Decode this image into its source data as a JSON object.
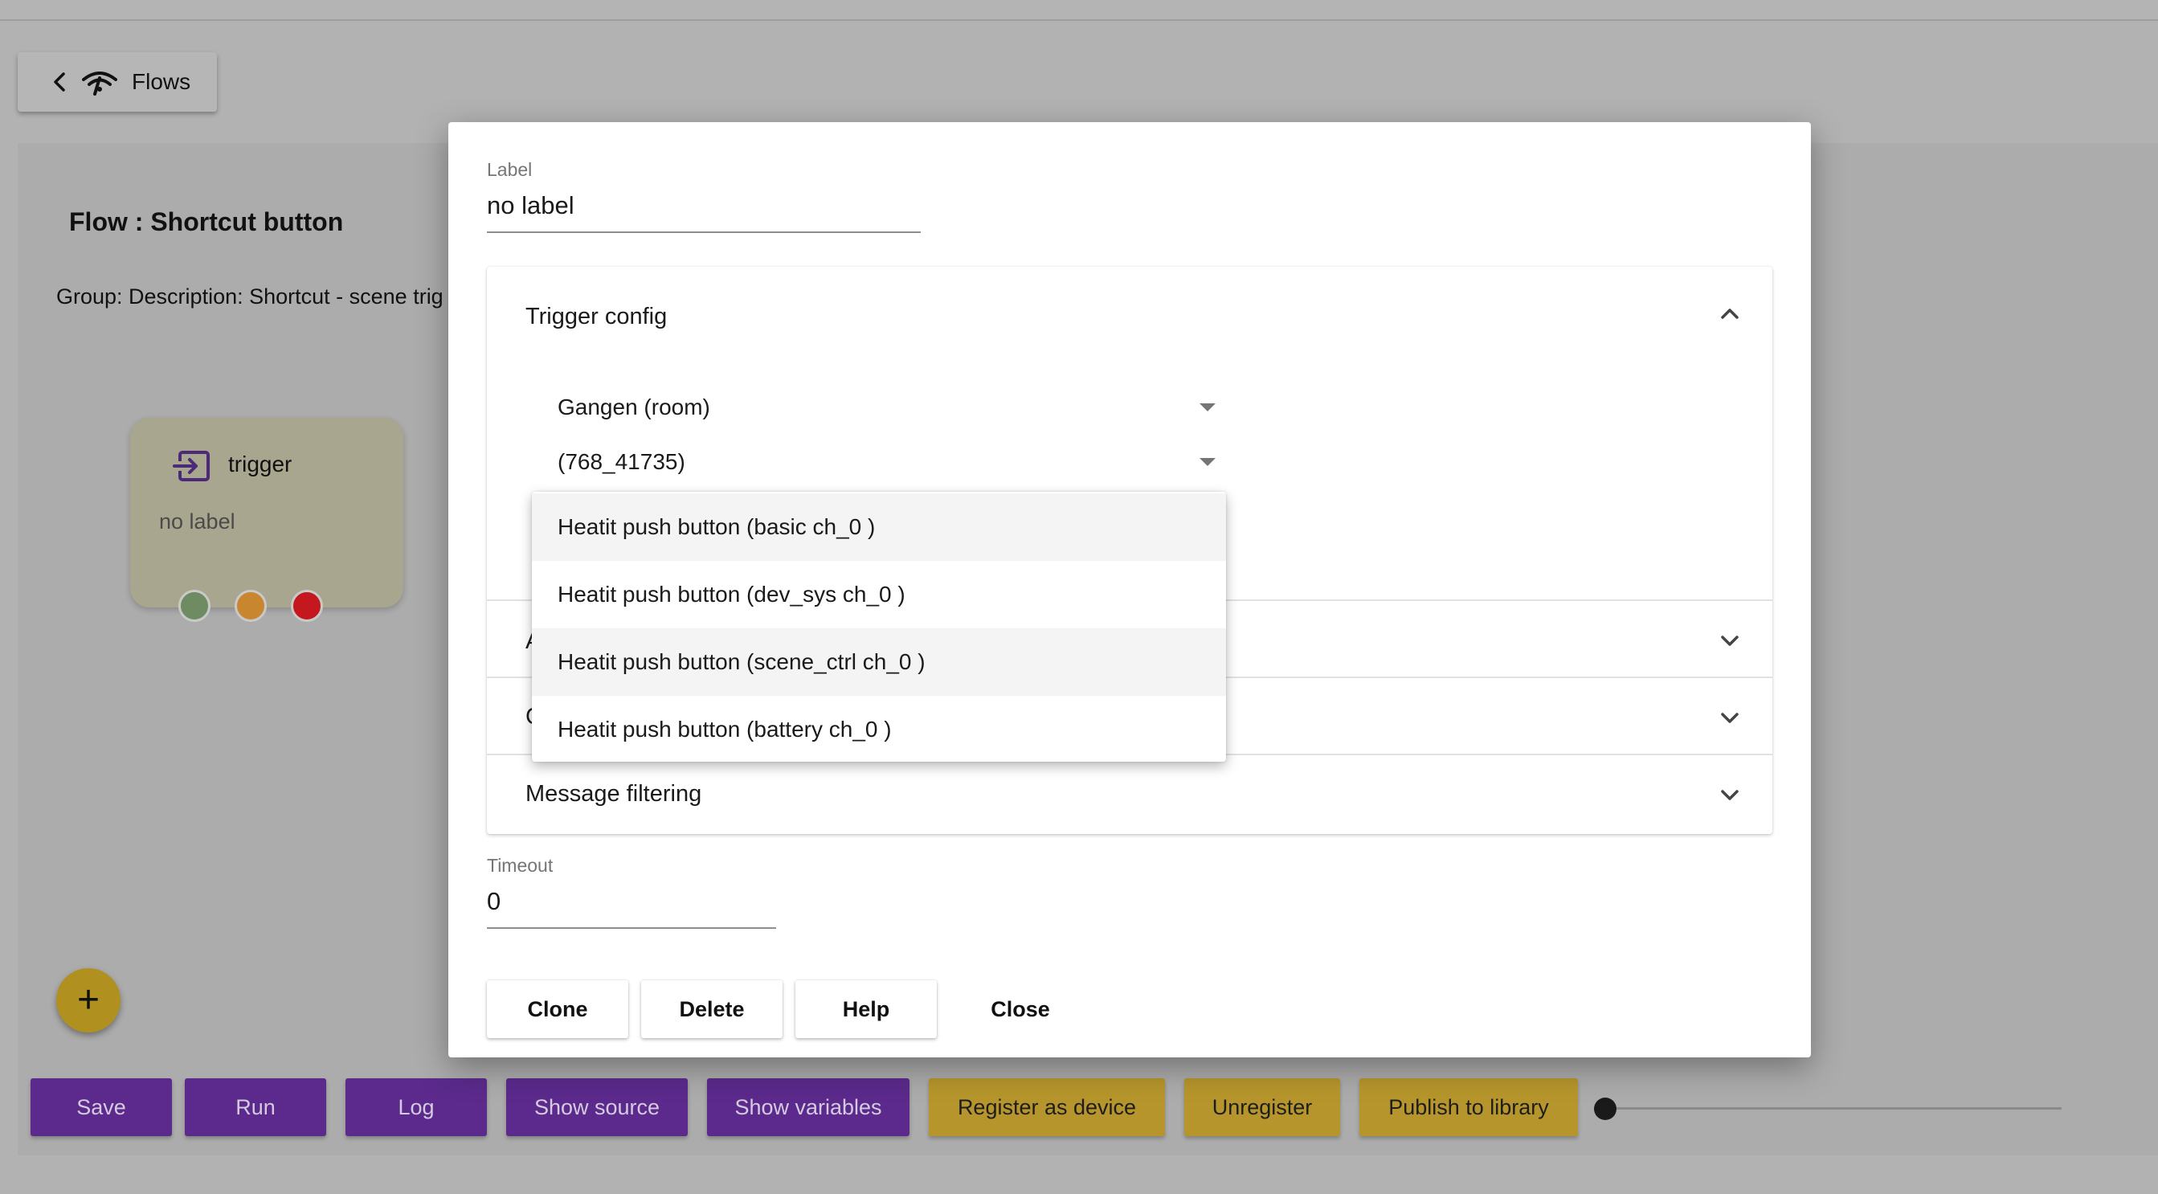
{
  "header": {
    "back_label": "Flows"
  },
  "flow": {
    "title": "Flow : Shortcut button",
    "description": "Group: Description: Shortcut - scene trig"
  },
  "node": {
    "name": "trigger",
    "label": "no label",
    "port_colors": [
      "#6f8b62",
      "#c8862e",
      "#c4171e"
    ]
  },
  "toolbar": {
    "buttons": [
      {
        "label": "Save",
        "color": "#5b2a8c"
      },
      {
        "label": "Run",
        "color": "#5b2a8c"
      },
      {
        "label": "Log",
        "color": "#5b2a8c"
      },
      {
        "label": "Show source",
        "color": "#5b2a8c"
      },
      {
        "label": "Show variables",
        "color": "#5b2a8c"
      },
      {
        "label": "Register as device",
        "color": "#b6962c"
      },
      {
        "label": "Unregister",
        "color": "#b6962c"
      },
      {
        "label": "Publish to library",
        "color": "#b6962c"
      }
    ],
    "slider_value": 0
  },
  "dialog": {
    "label_field": {
      "label": "Label",
      "value": "no label"
    },
    "sections": {
      "trigger_config": {
        "title": "Trigger config",
        "selects": [
          {
            "value": "Gangen (room)"
          },
          {
            "value": "(768_41735)"
          }
        ]
      },
      "section_a_partial": "A",
      "section_c_partial": "C",
      "message_filtering": "Message filtering"
    },
    "dropdown_options": [
      "Heatit push button (basic ch_0 )",
      "Heatit push button (dev_sys ch_0 )",
      "Heatit push button (scene_ctrl ch_0 )",
      "Heatit push button (battery ch_0 )"
    ],
    "timeout_field": {
      "label": "Timeout",
      "value": "0"
    },
    "buttons": {
      "clone": "Clone",
      "delete": "Delete",
      "help": "Help",
      "close": "Close"
    }
  },
  "fab": {
    "icon": "plus-icon",
    "symbol": "+"
  }
}
